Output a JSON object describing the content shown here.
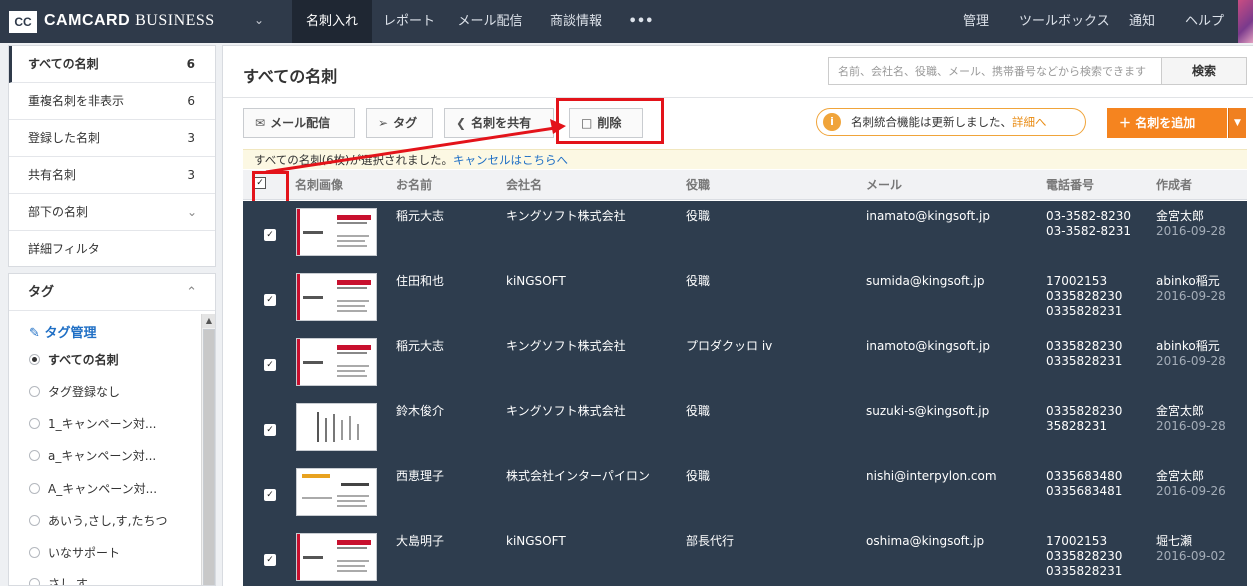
{
  "brand": {
    "logo": "CC",
    "name": "CAMCARD",
    "suffix": "BUSINESS"
  },
  "nav": [
    {
      "label": "名刺入れ"
    },
    {
      "label": "レポート"
    },
    {
      "label": "メール配信"
    },
    {
      "label": "商談情報"
    },
    {
      "label": "•••"
    }
  ],
  "nav_right": [
    {
      "label": "管理"
    },
    {
      "label": "ツールボックス"
    },
    {
      "label": "通知"
    },
    {
      "label": "ヘルプ"
    }
  ],
  "sidebar": {
    "items": [
      {
        "label": "すべての名刺",
        "count": "6"
      },
      {
        "label": "重複名刺を非表示",
        "count": "6"
      },
      {
        "label": "登録した名刺",
        "count": "3"
      },
      {
        "label": "共有名刺",
        "count": "3"
      },
      {
        "label": "部下の名刺",
        "count": ""
      },
      {
        "label": "詳細フィルタ",
        "count": ""
      }
    ]
  },
  "tags": {
    "heading": "タグ",
    "manage": "タグ管理",
    "items": [
      {
        "label": "すべての名刺"
      },
      {
        "label": "タグ登録なし"
      },
      {
        "label": "1_キャンペーン対..."
      },
      {
        "label": "a_キャンペーン対..."
      },
      {
        "label": "A_キャンペーン対..."
      },
      {
        "label": "あいう,さし,す,たちつ"
      },
      {
        "label": "いなサポート"
      },
      {
        "label": "さし,す"
      }
    ]
  },
  "main": {
    "title": "すべての名刺",
    "search_placeholder": "名前、会社名、役職、メール、携帯番号などから検索できます",
    "search_button": "検索",
    "toolbar": {
      "mail": "メール配信",
      "tag": "タグ",
      "share": "名刺を共有",
      "delete": "削除"
    },
    "notice_text": "名刺統合機能は更新しました、",
    "notice_link": "詳細へ",
    "add_button": "名刺を追加",
    "selection_text": "すべての名刺(6枚)が選択されました。",
    "selection_link": "キャンセルはこちらへ",
    "columns": [
      "名刺画像",
      "お名前",
      "会社名",
      "役職",
      "メール",
      "電話番号",
      "作成者"
    ]
  },
  "rows": [
    {
      "name": "稲元大志",
      "company": "キングソフト株式会社",
      "title": "役職",
      "email": "inamato@kingsoft.jp",
      "phones": [
        "03-3582-8230",
        "03-3582-8231"
      ],
      "creator": "金宮太郎",
      "date": "2016-09-28",
      "thumb": "h"
    },
    {
      "name": "住田和也",
      "company": "kiNGSOFT",
      "title": "役職",
      "email": "sumida@kingsoft.jp",
      "phones": [
        "17002153",
        "0335828230",
        "0335828231"
      ],
      "creator": "abinko稲元",
      "date": "2016-09-28",
      "thumb": "h"
    },
    {
      "name": "稲元大志",
      "company": "キングソフト株式会社",
      "title": "プロダクッロ iv",
      "email": "inamoto@kingsoft.jp",
      "phones": [
        "0335828230",
        "0335828231"
      ],
      "creator": "abinko稲元",
      "date": "2016-09-28",
      "thumb": "h"
    },
    {
      "name": "鈴木俊介",
      "company": "キングソフト株式会社",
      "title": "役職",
      "email": "suzuki-s@kingsoft.jp",
      "phones": [
        "0335828230",
        "35828231"
      ],
      "creator": "金宮太郎",
      "date": "2016-09-28",
      "thumb": "v"
    },
    {
      "name": "西恵理子",
      "company": "株式会社インターパイロン",
      "title": "役職",
      "email": "nishi@interpylon.com",
      "phones": [
        "0335683480",
        "0335683481"
      ],
      "creator": "金宮太郎",
      "date": "2016-09-26",
      "thumb": "y"
    },
    {
      "name": "大島明子",
      "company": "kiNGSOFT",
      "title": "部長代行",
      "email": "oshima@kingsoft.jp",
      "phones": [
        "17002153",
        "0335828230",
        "0335828231"
      ],
      "creator": "堀七瀬",
      "date": "2016-09-02",
      "thumb": "h"
    }
  ]
}
